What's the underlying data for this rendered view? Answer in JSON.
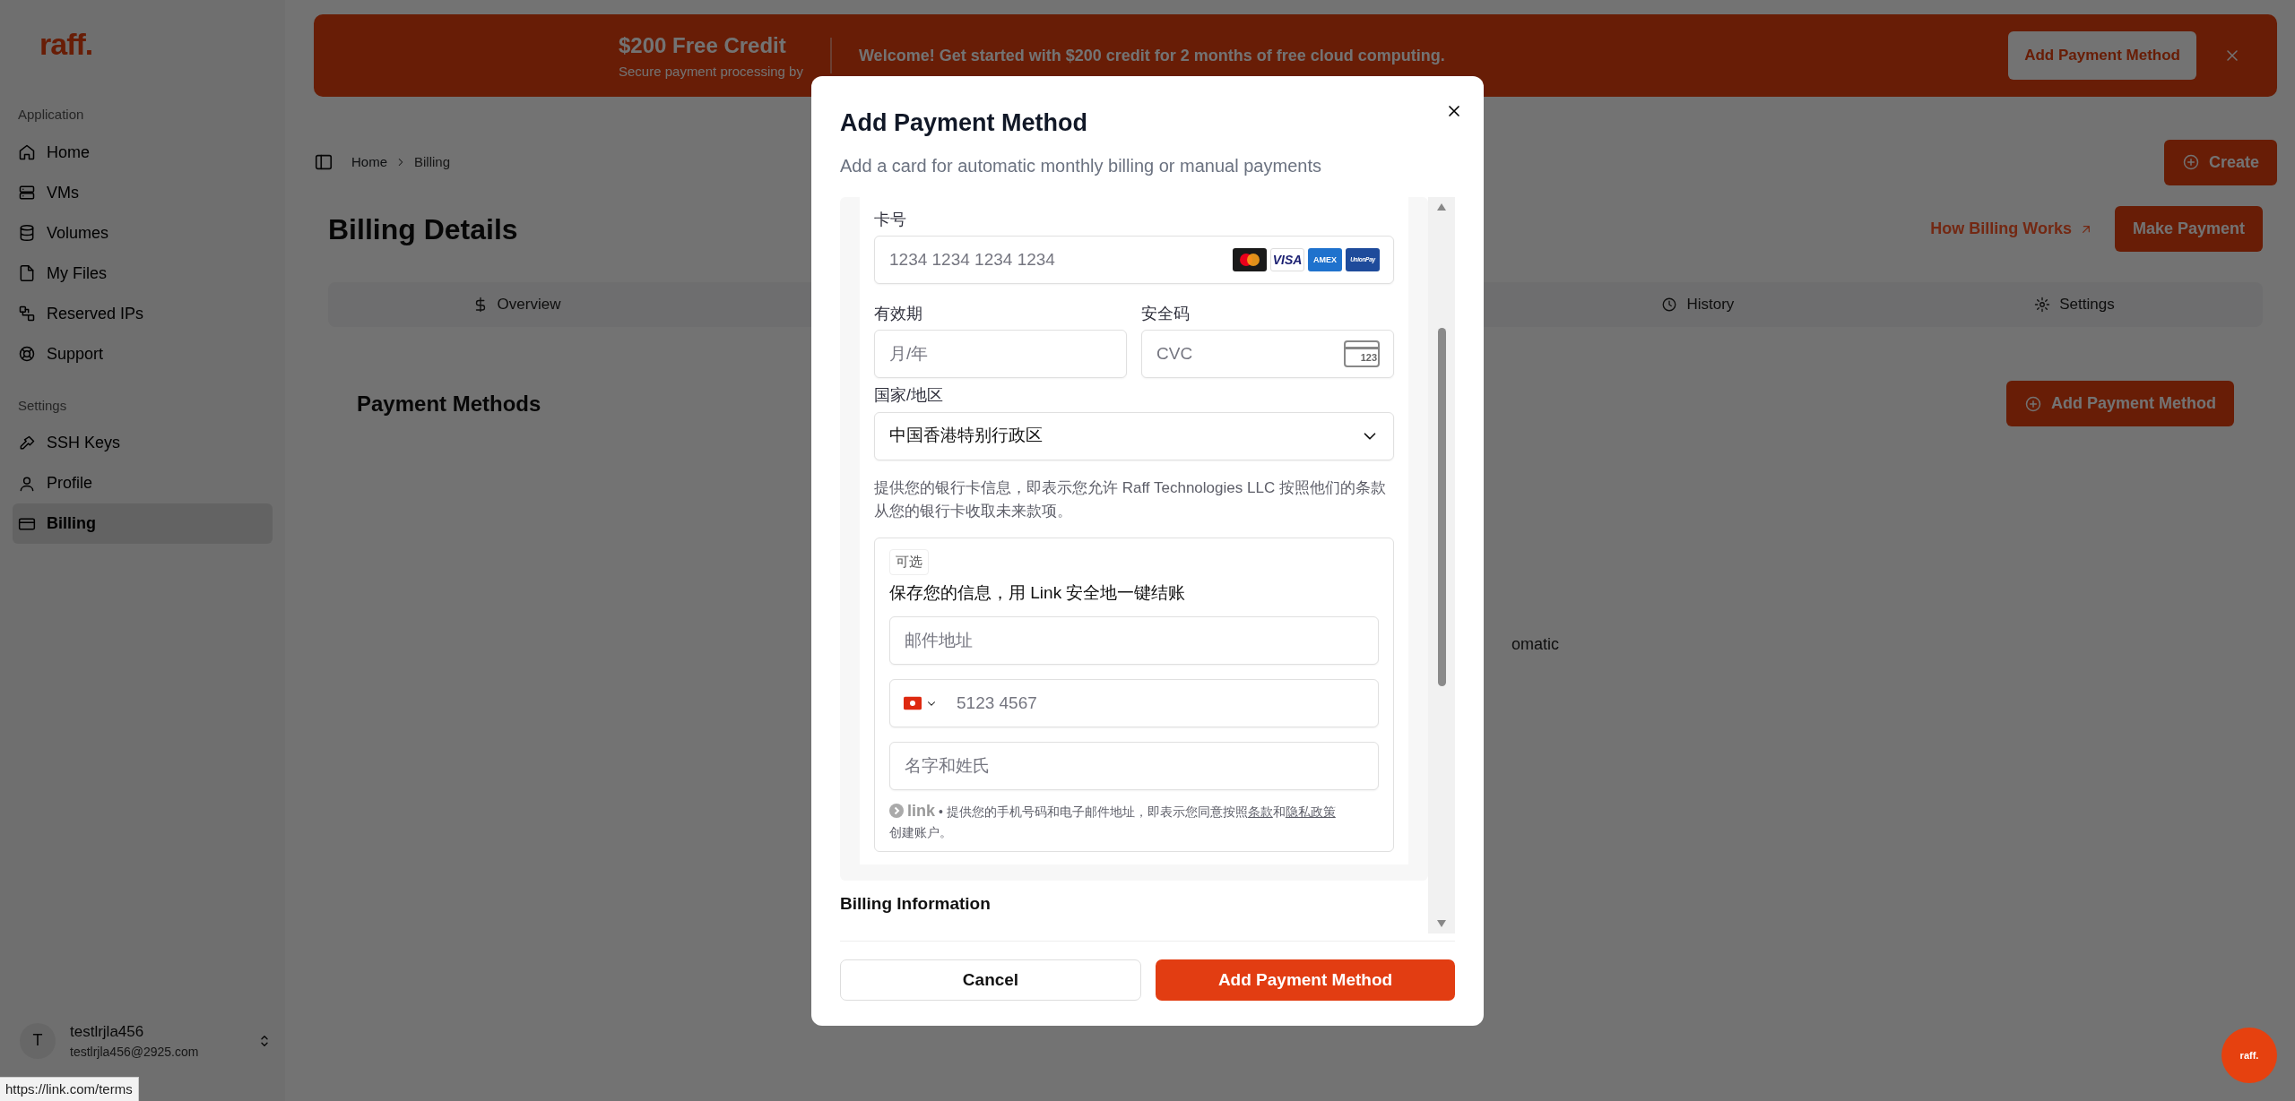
{
  "sidebar": {
    "logo": "raff.",
    "sections": [
      {
        "title": "Application",
        "items": [
          {
            "label": "Home",
            "selected": false
          },
          {
            "label": "VMs",
            "selected": false
          },
          {
            "label": "Volumes",
            "selected": false
          },
          {
            "label": "My Files",
            "selected": false
          },
          {
            "label": "Reserved IPs",
            "selected": false
          },
          {
            "label": "Support",
            "selected": false
          }
        ]
      },
      {
        "title": "Settings",
        "items": [
          {
            "label": "SSH Keys",
            "selected": false
          },
          {
            "label": "Profile",
            "selected": false
          },
          {
            "label": "Billing",
            "selected": true
          }
        ]
      }
    ],
    "user": {
      "initial": "T",
      "name": "testlrjla456",
      "email": "testlrjla456@2925.com"
    }
  },
  "banner": {
    "title": "$200 Free Credit",
    "subtitle": "Secure payment processing by",
    "message": "Welcome! Get started with $200 credit for 2 months of free cloud computing.",
    "button": "Add Payment Method"
  },
  "breadcrumb": [
    "Home",
    "Billing"
  ],
  "create_button": "Create",
  "page": {
    "title": "Billing Details",
    "link": "How Billing Works",
    "button": "Make Payment"
  },
  "tabs": [
    {
      "label": "Overview",
      "selected": false
    },
    {
      "label": "History",
      "selected": false
    },
    {
      "label": "Settings",
      "selected": false
    }
  ],
  "payment_methods": {
    "title": "Payment Methods",
    "button": "Add Payment Method",
    "text": "omatic"
  },
  "modal": {
    "title": "Add Payment Method",
    "subtitle": "Add a card for automatic monthly billing or manual payments",
    "card_number": {
      "label": "卡号",
      "placeholder": "1234 1234 1234 1234",
      "brands": [
        {
          "kind": "mastercard"
        },
        {
          "kind": "visa",
          "text": "VISA"
        },
        {
          "kind": "amex",
          "text": "AMEX"
        },
        {
          "kind": "unionpay",
          "text": "UnionPay"
        }
      ]
    },
    "expiry": {
      "label": "有效期",
      "placeholder": "月/年"
    },
    "cvc": {
      "label": "安全码",
      "placeholder": "CVC",
      "icon_text": "123"
    },
    "country": {
      "label": "国家/地区",
      "value": "中国香港特别行政区"
    },
    "consent": "提供您的银行卡信息，即表示您允许 Raff Technologies LLC 按照他们的条款从您的银行卡收取未来款项。",
    "link_box": {
      "badge": "可选",
      "title": "保存您的信息，用 Link 安全地一键结账",
      "email_placeholder": "邮件地址",
      "phone_placeholder": "5123 4567",
      "name_placeholder": "名字和姓氏",
      "logo": "link",
      "legal_before": "• 提供您的手机号码和电子邮件地址，即表示您同意按照",
      "terms": "条款",
      "and": "和",
      "privacy": "隐私政策",
      "legal_after": "创建账户。"
    },
    "next_section": "Billing Information",
    "cancel": "Cancel",
    "submit": "Add Payment Method"
  },
  "status_bar": "https://link.com/terms",
  "fab": "raff."
}
